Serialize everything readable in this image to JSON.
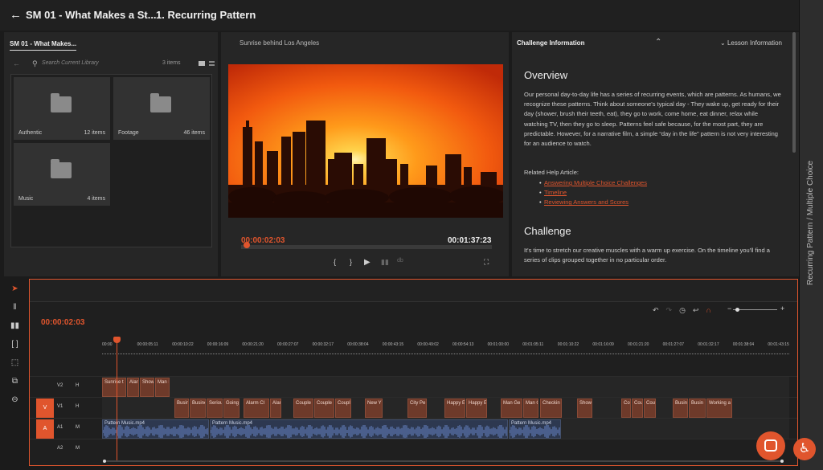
{
  "topbar": {
    "back_icon": "arrow-left-icon",
    "course_title": "SM 01 - What Makes a St...",
    "separator_icon": "chevron-right-icon",
    "lesson_title": "1. Recurring Pattern"
  },
  "right_strip": {
    "label": "Recurring Pattern / Multiple Choice"
  },
  "library": {
    "tab": "SM 01 - What Makes...",
    "search_placeholder": "Search Current Library",
    "item_count": "3 items",
    "folders": [
      {
        "name": "Authentic",
        "count": "12 items"
      },
      {
        "name": "Footage",
        "count": "46 items"
      },
      {
        "name": "Music",
        "count": "4 items"
      }
    ]
  },
  "viewer": {
    "title": "Sunrise behind Los Angeles",
    "current_time": "00:00:02:03",
    "duration": "00:01:37:23",
    "controls": {
      "in": "{",
      "out": "}",
      "play": "▶",
      "fit": "⛶"
    }
  },
  "info": {
    "tab_challenge": "Challenge Information",
    "tab_lesson": "Lesson Information",
    "overview_heading": "Overview",
    "overview_text": "Our personal day-to-day life has a series of recurring events, which are patterns. As humans, we recognize these patterns. Think about someone's typical day - They wake up, get ready for their day (shower, brush their teeth, eat), they go to work, come home, eat dinner, relax while watching TV, then they go to sleep. Patterns feel safe because, for the most part, they are predictable. However, for a narrative film, a simple “day in the life” pattern is not very interesting for an audience to watch.",
    "related_heading": "Related Help Article:",
    "links": [
      "Answering Multiple Choice Challenges",
      "Timeline",
      "Reviewing Answers and Scores"
    ],
    "challenge_heading": "Challenge",
    "challenge_text": "It's time to stretch our creative muscles with a warm up exercise. On the timeline you'll find a series of clips grouped together in no particular order."
  },
  "timeline": {
    "timecode": "00:00:02:03",
    "ruler": [
      "00:00",
      "00:00:05:11",
      "00:00:10:22",
      "00:00:16:09",
      "00:00:21:20",
      "00:00:27:07",
      "00:00:32:17",
      "00:00:38:04",
      "00:00:43:15",
      "00:00:49:02",
      "00:00:54:13",
      "00:01:00:00",
      "00:01:05:11",
      "00:01:10:22",
      "00:01:16:09",
      "00:01:21:20",
      "00:01:27:07",
      "00:01:32:17",
      "00:01:38:04",
      "00:01:43:15"
    ],
    "tracks": [
      {
        "name": "V2",
        "btn": "H",
        "src": ""
      },
      {
        "name": "V1",
        "btn": "H",
        "src": "V"
      },
      {
        "name": "A1",
        "btn": "M",
        "src": "A"
      },
      {
        "name": "A2",
        "btn": "M",
        "src": ""
      }
    ],
    "v2_clips": [
      "Sunrise t",
      "Alar",
      "Show",
      "Man I"
    ],
    "v1_clips": [
      "Busin",
      "Busine",
      "Seriou",
      "Going",
      "Alarm Cl",
      "Alar",
      "Couple",
      "Couple",
      "Coupl",
      "New Y",
      "City Pe",
      "Happy E",
      "Happy E",
      "Man Ge",
      "Man Ge",
      "Checkin",
      "Show",
      "Co",
      "Cou",
      "Coup",
      "Busin",
      "Busin",
      "Working a"
    ],
    "a1_clips": [
      "Pattern Music.mp4",
      "Pattern Music.mp4",
      "Pattern Music.mp4"
    ]
  },
  "colors": {
    "accent": "#e0552d",
    "panel": "#262626",
    "bg": "#1b1b1b",
    "video_clip": "#6e3a2a",
    "audio_clip": "#2d3850"
  }
}
